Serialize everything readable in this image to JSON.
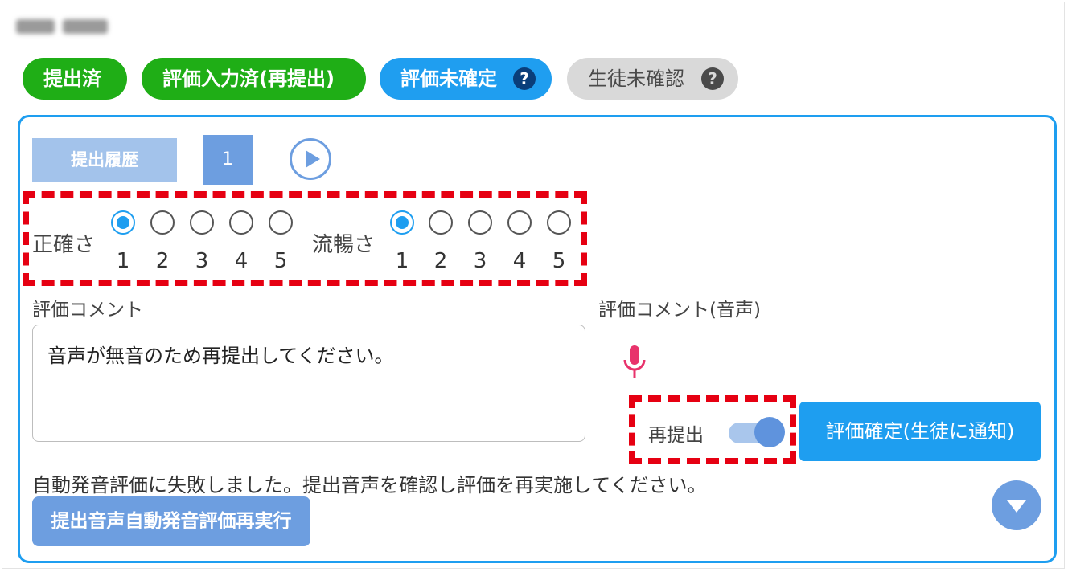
{
  "status_pills": [
    {
      "label": "提出済",
      "color": "#1fae16"
    },
    {
      "label": "評価入力済(再提出)",
      "color": "#1fae16"
    },
    {
      "label": "評価未確定",
      "color": "#1f9ef0",
      "help": "?"
    },
    {
      "label": "生徒未確認",
      "color": "#d9d9d9",
      "help": "?"
    }
  ],
  "history": {
    "button_label": "提出履歴",
    "current_page": "1",
    "next_icon": "play-circle-icon"
  },
  "ratings": {
    "accuracy": {
      "label": "正確さ",
      "options": [
        "1",
        "2",
        "3",
        "4",
        "5"
      ],
      "selected": "1"
    },
    "fluency": {
      "label": "流暢さ",
      "options": [
        "1",
        "2",
        "3",
        "4",
        "5"
      ],
      "selected": "1"
    }
  },
  "comment": {
    "label": "評価コメント",
    "value": "音声が無音のため再提出してください。"
  },
  "voice_comment": {
    "label": "評価コメント(音声)",
    "icon": "microphone-icon",
    "icon_color": "#e8336c"
  },
  "resubmit": {
    "label": "再提出",
    "on": true
  },
  "confirm_button": "評価確定(生徒に通知)",
  "error_message": "自動発音評価に失敗しました。提出音声を確認し評価を再実施してください。",
  "retry_button": "提出音声自動発音評価再実行",
  "collapse_icon": "chevron-down-circle-icon",
  "accent_color": "#1e9ef0",
  "highlight_color": "#e60012"
}
